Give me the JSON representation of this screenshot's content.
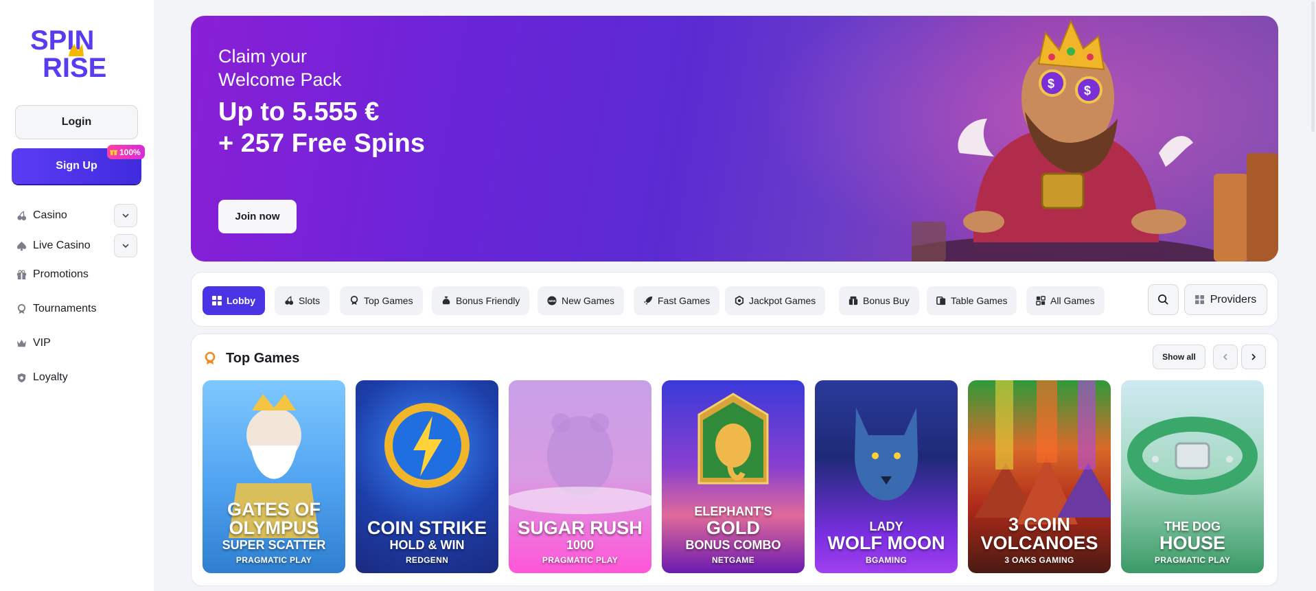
{
  "brand": {
    "logo_line1": "SPIN",
    "logo_line2": "RISE"
  },
  "auth": {
    "login_label": "Login",
    "signup_label": "Sign Up",
    "signup_badge": "100%"
  },
  "nav": [
    {
      "label": "Casino",
      "icon": "cherries-icon",
      "expandable": true
    },
    {
      "label": "Live Casino",
      "icon": "spade-icon",
      "expandable": true
    },
    {
      "label": "Promotions",
      "icon": "gift-icon",
      "expandable": false
    },
    {
      "label": "Tournaments",
      "icon": "trophy-icon",
      "expandable": false
    },
    {
      "label": "VIP",
      "icon": "crown-icon",
      "expandable": false
    },
    {
      "label": "Loyalty",
      "icon": "shield-icon",
      "expandable": false
    }
  ],
  "hero": {
    "subtitle_line1": "Claim your",
    "subtitle_line2": "Welcome Pack",
    "title_line1": "Up to 5.555 €",
    "title_line2": "+ 257 Free Spins",
    "cta_label": "Join now"
  },
  "categories": [
    {
      "label": "Lobby",
      "icon": "grid-icon",
      "active": true
    },
    {
      "label": "Slots",
      "icon": "cherries-icon",
      "active": false
    },
    {
      "label": "Top Games",
      "icon": "medal-icon",
      "active": false
    },
    {
      "label": "Bonus Friendly",
      "icon": "money-bag-icon",
      "active": false
    },
    {
      "label": "New Games",
      "icon": "new-badge-icon",
      "active": false
    },
    {
      "label": "Fast Games",
      "icon": "rocket-icon",
      "active": false
    },
    {
      "label": "Jackpot Games",
      "icon": "jackpot-icon",
      "active": false
    },
    {
      "label": "Bonus Buy",
      "icon": "bonus-box-icon",
      "active": false
    },
    {
      "label": "Table Games",
      "icon": "cards-icon",
      "active": false
    },
    {
      "label": "All Games",
      "icon": "all-games-icon",
      "active": false
    }
  ],
  "toolbar": {
    "providers_label": "Providers"
  },
  "top_games": {
    "title": "Top Games",
    "show_all_label": "Show all",
    "games": [
      {
        "lines": [
          "GATES OF",
          "OLYMPUS",
          "SUPER SCATTER"
        ],
        "provider": "PRAGMATIC PLAY",
        "colors": [
          "#4fb4ff",
          "#2f86d8"
        ]
      },
      {
        "lines": [
          "",
          "COIN STRIKE",
          "HOLD & WIN"
        ],
        "provider": "REDGENN",
        "colors": [
          "#1f3fb8",
          "#1f8cff"
        ]
      },
      {
        "lines": [
          "",
          "SUGAR RUSH",
          "1000"
        ],
        "provider": "PRAGMATIC PLAY",
        "colors": [
          "#c98ae6",
          "#ff3fd0"
        ]
      },
      {
        "lines": [
          "ELEPHANT'S",
          "GOLD",
          "BONUS COMBO"
        ],
        "provider": "NETGAME",
        "colors": [
          "#3a2bd0",
          "#e25bbd"
        ]
      },
      {
        "lines": [
          "LADY",
          "WOLF MOON",
          ""
        ],
        "provider": "BGAMING",
        "colors": [
          "#1d2f8c",
          "#8a2fe8"
        ]
      },
      {
        "lines": [
          "3 COIN",
          "VOLCANOES",
          ""
        ],
        "provider": "3 OAKS GAMING",
        "colors": [
          "#1f8f3c",
          "#5a1a14"
        ]
      },
      {
        "lines": [
          "THE DOG",
          "HOUSE",
          ""
        ],
        "provider": "PRAGMATIC PLAY",
        "colors": [
          "#7cc9a0",
          "#2f8a5a"
        ]
      }
    ]
  }
}
